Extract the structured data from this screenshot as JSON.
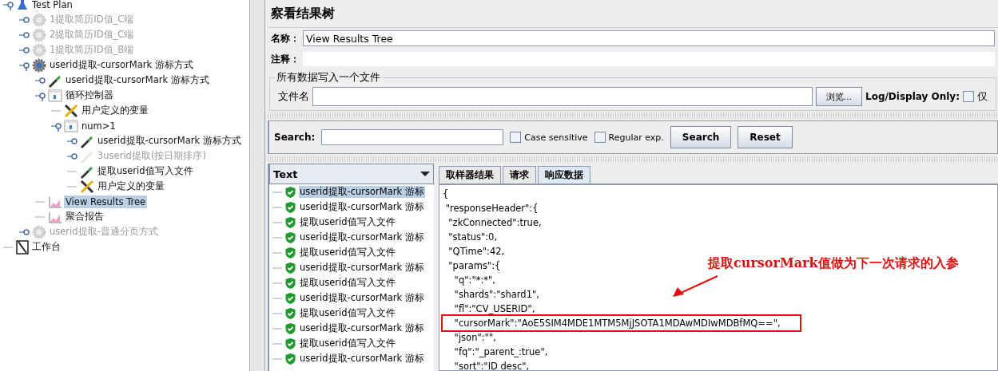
{
  "tree": [
    {
      "label": "Test Plan",
      "kind": "plan",
      "disabled": false,
      "selected": false,
      "expanded": true,
      "children": [
        {
          "label": "1提取简历ID值_C端",
          "kind": "thread",
          "disabled": true,
          "selected": false,
          "expanded": false
        },
        {
          "label": "2提取简历ID值_C端",
          "kind": "thread",
          "disabled": true,
          "selected": false,
          "expanded": false
        },
        {
          "label": "1提取简历ID值_B端",
          "kind": "thread",
          "disabled": true,
          "selected": false,
          "expanded": false
        },
        {
          "label": "userid提取-cursorMark 游标方式",
          "kind": "thread",
          "disabled": false,
          "selected": false,
          "expanded": true,
          "children": [
            {
              "label": "userid提取-cursorMark 游标方式",
              "kind": "sampler",
              "disabled": false,
              "selected": false,
              "expanded": false
            },
            {
              "label": "循环控制器",
              "kind": "controller",
              "disabled": false,
              "selected": false,
              "expanded": true,
              "children": [
                {
                  "label": "用户定义的变量",
                  "kind": "config",
                  "disabled": false,
                  "selected": false
                },
                {
                  "label": "num>1",
                  "kind": "controller",
                  "disabled": false,
                  "selected": false,
                  "expanded": true,
                  "children": [
                    {
                      "label": "userid提取-cursorMark 游标方式",
                      "kind": "sampler",
                      "disabled": false,
                      "selected": false,
                      "expanded": false
                    },
                    {
                      "label": "3userid提取(按日期排序)",
                      "kind": "sampler",
                      "disabled": true,
                      "selected": false,
                      "expanded": false
                    },
                    {
                      "label": "提取userid值写入文件",
                      "kind": "sampler",
                      "disabled": false,
                      "selected": false
                    },
                    {
                      "label": "用户定义的变量",
                      "kind": "config",
                      "disabled": false,
                      "selected": false
                    }
                  ]
                }
              ]
            },
            {
              "label": "View Results Tree",
              "kind": "listener",
              "disabled": false,
              "selected": true
            },
            {
              "label": "聚合报告",
              "kind": "listener",
              "disabled": false,
              "selected": false
            }
          ]
        },
        {
          "label": "userid提取-普通分页方式",
          "kind": "thread",
          "disabled": true,
          "selected": false,
          "expanded": false
        }
      ]
    },
    {
      "label": "工作台",
      "kind": "workbench",
      "disabled": false,
      "selected": false
    }
  ],
  "panel": {
    "title": "察看结果树",
    "name_label": "名称：",
    "name_value": "View Results Tree",
    "comment_label": "注释：",
    "file_group": {
      "legend": "所有数据写入一个文件",
      "file_label": "文件名",
      "browse": "浏览...",
      "log_label": "Log/Display Only:",
      "log_checkbox": {
        "label": "仅",
        "checked": false
      }
    },
    "search": {
      "label": "Search:",
      "case_sensitive": {
        "label": "Case sensitive",
        "checked": false
      },
      "regular_exp": {
        "label": "Regular exp.",
        "checked": false
      },
      "search_button": "Search",
      "reset_button": "Reset"
    },
    "renderer": "Text",
    "results": [
      {
        "label": "userid提取-cursorMark 游标",
        "selected": true
      },
      {
        "label": "userid提取-cursorMark 游标",
        "selected": false
      },
      {
        "label": "提取userid值写入文件",
        "selected": false
      },
      {
        "label": "userid提取-cursorMark 游标",
        "selected": false
      },
      {
        "label": "提取userid值写入文件",
        "selected": false
      },
      {
        "label": "userid提取-cursorMark 游标",
        "selected": false
      },
      {
        "label": "提取userid值写入文件",
        "selected": false
      },
      {
        "label": "userid提取-cursorMark 游标",
        "selected": false
      },
      {
        "label": "提取userid值写入文件",
        "selected": false
      },
      {
        "label": "userid提取-cursorMark 游标",
        "selected": false
      },
      {
        "label": "提取userid值写入文件",
        "selected": false
      },
      {
        "label": "userid提取-cursorMark 游标",
        "selected": false
      }
    ],
    "tabs": [
      {
        "label": "取样器结果",
        "selected": false
      },
      {
        "label": "请求",
        "selected": false
      },
      {
        "label": "响应数据",
        "selected": true
      }
    ],
    "response_lines": [
      {
        "text": "{",
        "highlighted": false
      },
      {
        "text": " \"responseHeader\":{",
        "highlighted": false
      },
      {
        "text": "  \"zkConnected\":true,",
        "highlighted": false
      },
      {
        "text": "  \"status\":0,",
        "highlighted": false
      },
      {
        "text": "  \"QTime\":42,",
        "highlighted": false
      },
      {
        "text": "  \"params\":{",
        "highlighted": false
      },
      {
        "text": "    \"q\":\"*:*\",",
        "highlighted": false
      },
      {
        "text": "    \"shards\":\"shard1\",",
        "highlighted": false
      },
      {
        "text": "    \"fl\":\"CV_USERID\",",
        "highlighted": false
      },
      {
        "text": "    \"cursorMark\":\"AoE5SIM4MDE1MTM5MjJSOTA1MDAwMDIwMDBfMQ==\",",
        "highlighted": true
      },
      {
        "text": "    \"json\":\"\",",
        "highlighted": false
      },
      {
        "text": "    \"fq\":\"_parent_:true\",",
        "highlighted": false
      },
      {
        "text": "    \"sort\":\"ID desc\",",
        "highlighted": false
      }
    ],
    "annotation": "提取cursorMark值做为下一次请求的入参"
  }
}
